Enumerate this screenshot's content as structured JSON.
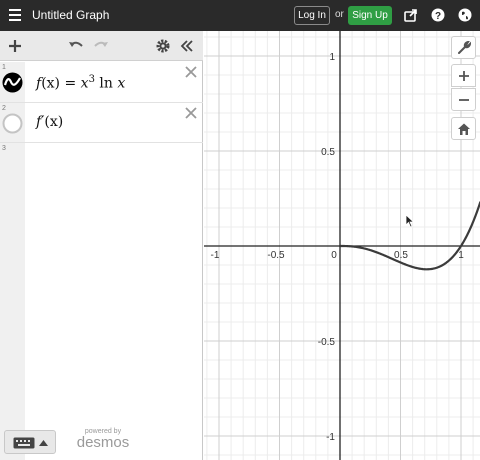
{
  "header": {
    "title": "Untitled Graph",
    "login_label": "Log In",
    "or_text": "or",
    "signup_label": "Sign Up",
    "icons": [
      "menu-icon",
      "share-icon",
      "help-icon",
      "globe-icon"
    ]
  },
  "toolbar": {
    "icons": [
      "add-icon",
      "undo-icon",
      "redo-icon",
      "settings-icon",
      "collapse-icon"
    ]
  },
  "expressions": [
    {
      "num": "1",
      "latex": "f(x)=x^3 ln x",
      "text_f": "f",
      "text_arg": "(x)",
      "text_eq": "=",
      "text_base": "x",
      "text_exp": "3",
      "text_fn": "ln",
      "text_var": "x",
      "color": "#000000",
      "visible": true
    },
    {
      "num": "2",
      "latex": "f'(x)",
      "text_fp": "f′",
      "text_arg": "(x)",
      "color": "#000000",
      "visible": false
    },
    {
      "num": "3",
      "latex": ""
    }
  ],
  "footer": {
    "powered_by": "powered by",
    "brand": "desmos",
    "keyboard_icon": "keyboard-icon"
  },
  "graph": {
    "x_ticks": [
      "-1",
      "-0.5",
      "0",
      "0.5",
      "1"
    ],
    "y_ticks": [
      "1",
      "0.5",
      "-0.5",
      "-1"
    ],
    "side_icons": [
      "wrench-icon",
      "zoom-in-icon",
      "zoom-out-icon",
      "home-icon"
    ],
    "curve_color": "#3b3b3b",
    "grid_minor": "#ececec",
    "grid_major": "#cfcfcf"
  }
}
